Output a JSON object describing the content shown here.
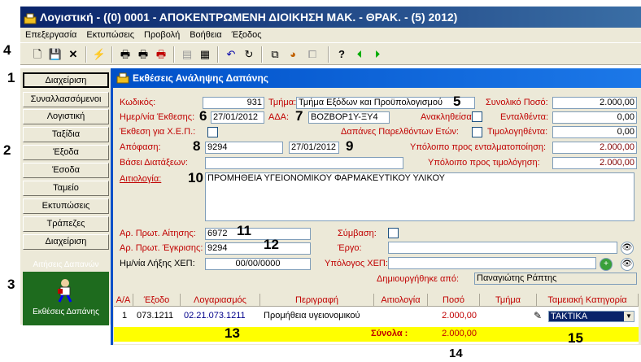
{
  "window": {
    "title": "Λογιστική - ((0) 0001 - ΑΠΟΚΕΝΤΡΩΜΕΝΗ ΔΙΟΙΚΗΣΗ  ΜΑΚ. - ΘΡΑΚ. - (5) 2012)"
  },
  "menu": [
    "Επεξεργασία",
    "Εκτυπώσεις",
    "Προβολή",
    "Βοήθεια",
    "Έξοδος"
  ],
  "markers": [
    "1",
    "2",
    "3",
    "4",
    "5",
    "6",
    "7",
    "8",
    "9",
    "10",
    "11",
    "12",
    "13",
    "14",
    "15"
  ],
  "sidebar": {
    "items": [
      "Διαχείριση",
      "Συναλλασσόμενοι",
      "Λογιστική",
      "Ταξίδια",
      "Έξοδα",
      "Έσοδα",
      "Ταμείο",
      "Εκτυπώσεις",
      "Τράπεζες",
      "Διαχείριση"
    ],
    "green_top": "Αιτήσεις Δαπανών",
    "green_bottom": "Εκθέσεις Δαπάνης"
  },
  "panel": {
    "title": "Εκθέσεις Ανάληψης Δαπάνης"
  },
  "form": {
    "kodikos_label": "Κωδικός:",
    "kodikos": "931",
    "tmima_label": "Τμήμα:",
    "tmima": "Τμήμα Εξόδων και Προϋπολογισμού",
    "synoliko_label": "Συνολικό Ποσό:",
    "synoliko": "2.000,00",
    "hmer_label": "Ημερ/νία Έκθεσης:",
    "hmer": "27/01/2012",
    "ada_label": "ΑΔΑ:",
    "ada": "ΒΟΖΒΟΡ1Υ-ΞΥ4",
    "anaklithisa_label": "Ανακληθείσα:",
    "entaltenta_label": "Ενταλθέντα:",
    "entaltenta": "0,00",
    "xep_label": "Έκθεση για Χ.Ε.Π.:",
    "dapanes_label": "Δαπάνες Παρελθόντων Ετών:",
    "timologithenta_label": "Τιμολογηθέντα:",
    "timologithenta": "0,00",
    "apofasi_label": "Απόφαση:",
    "apofasi": "9294",
    "apofasi_date": "27/01/2012",
    "ypol_ent_label": "Υπόλοιπο προς ενταλματοποίηση:",
    "ypol_ent": "2.000,00",
    "vasei_label": "Βάσει Διατάξεων:",
    "ypol_tim_label": "Υπόλοιπο προς τιμολόγηση:",
    "ypol_tim": "2.000,00",
    "aitiologia_label": "Αιτιολογία:",
    "aitiologia": "ΠΡΟΜΗΘΕΙΑ ΥΓΕΙΟΝΟΜΙΚΟΥ ΦΑΡΜΑΚΕΥΤΙΚΟΥ ΥΛΙΚΟΥ",
    "ar_aitisis_label": "Αρ. Πρωτ. Αίτησης:",
    "ar_aitisis": "6972",
    "symvasi_label": "Σύμβαση:",
    "ar_egkrisis_label": "Αρ. Πρωτ. Έγκρισης:",
    "ar_egkrisis": "9294",
    "ergo_label": "Έργο:",
    "lixi_label": "Ημ/νία Λήξης ΧΕΠ:",
    "lixi": "00/00/0000",
    "ypologos_label": "Υπόλογος ΧΕΠ:",
    "dimiourgithike_label": "Δημιουργήθηκε από:",
    "dimiourgithike": "Παναγιώτης Ράπτης"
  },
  "table": {
    "headers": [
      "Α/Α",
      "Έξοδο",
      "Λογαριασμός",
      "Περιγραφή",
      "Αιτιολογία",
      "Ποσό",
      "Τμήμα",
      "Ταμειακή Κατηγορία"
    ],
    "row": [
      "1",
      "073.1211",
      "02.21.073.1211",
      "Προμήθεια υγειονομικού",
      "",
      "2.000,00",
      "",
      "ΤΑΚΤΙΚΑ"
    ],
    "totals_label": "Σύνολα   :",
    "totals_value": "2.000,00"
  },
  "colors": {
    "title": "#0a246a",
    "panel_header": "#0050c8",
    "label_red": "#c00000",
    "totals": "#ffff00",
    "green": "#1e6b1e"
  }
}
